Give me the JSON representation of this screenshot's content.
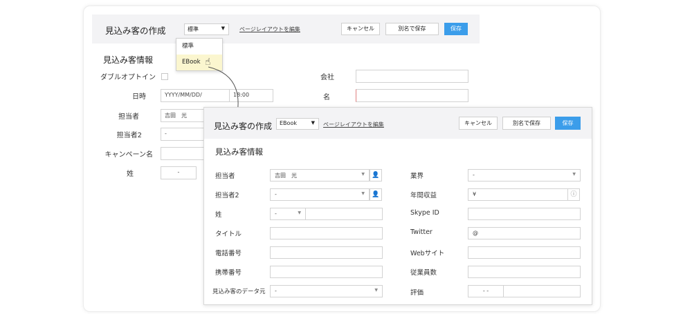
{
  "background_form": {
    "title": "見込み客の作成",
    "layout_select": "標準",
    "layout_link": "ページレイアウトを編集",
    "cancel": "キャンセル",
    "save_new": "別名で保存",
    "save": "保存",
    "dropdown_options": [
      "標準",
      "EBook"
    ],
    "section_title": "見込み客情報",
    "labels": {
      "double_optin": "ダブルオプトイン",
      "datetime": "日時",
      "owner": "担当者",
      "owner2": "担当者2",
      "campaign": "キャンペーン名",
      "last_name": "姓",
      "company": "会社",
      "first_name": "名"
    },
    "values": {
      "date_placeholder": "YYYY/MM/DD/",
      "time": "18:00",
      "owner": "吉田　光",
      "owner2": "-",
      "last_name_prefix": "-"
    }
  },
  "foreground_form": {
    "title": "見込み客の作成",
    "layout_select": "EBook",
    "layout_link": "ページレイアウトを編集",
    "cancel": "キャンセル",
    "save_new": "別名で保存",
    "save": "保存",
    "section_title": "見込み客情報",
    "left_labels": [
      "担当者",
      "担当者2",
      "姓",
      "タイトル",
      "電話番号",
      "携帯番号",
      "見込み客のデータ元"
    ],
    "right_labels": [
      "業界",
      "年間収益",
      "Skype ID",
      "Twitter",
      "Webサイト",
      "従業員数",
      "評価"
    ],
    "values": {
      "owner": "吉田　光",
      "owner2": "-",
      "last_name_prefix": "-",
      "lead_source": "-",
      "industry": "-",
      "revenue_prefix": "¥",
      "twitter_prefix": "@",
      "rating": "- -"
    }
  }
}
